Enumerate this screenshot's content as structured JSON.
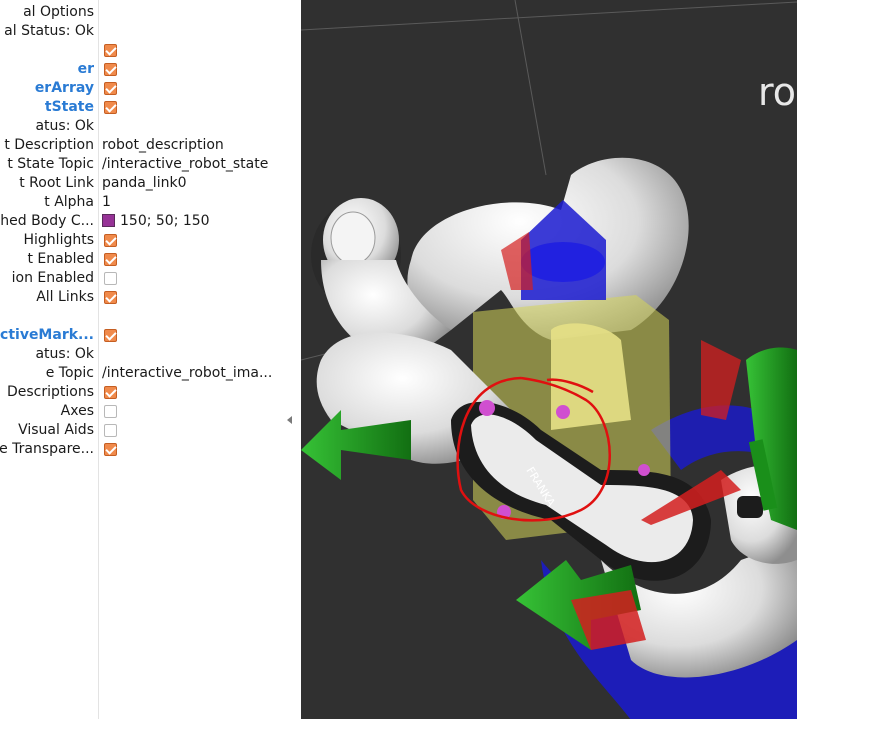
{
  "panel": {
    "rows": [
      {
        "name": "al Options",
        "type": "header"
      },
      {
        "name": "al Status: Ok",
        "type": "text"
      },
      {
        "name": "",
        "checked": true,
        "type": "check"
      },
      {
        "name": "er",
        "checked": true,
        "type": "link-check"
      },
      {
        "name": "erArray",
        "checked": true,
        "type": "link-check"
      },
      {
        "name": "tState",
        "checked": true,
        "type": "link-check"
      },
      {
        "name": "atus: Ok",
        "type": "text"
      },
      {
        "name": "t Description",
        "value": "robot_description",
        "type": "value"
      },
      {
        "name": "t State Topic",
        "value": "/interactive_robot_state",
        "type": "value"
      },
      {
        "name": "t Root Link",
        "value": "panda_link0",
        "type": "value"
      },
      {
        "name": "t Alpha",
        "value": "1",
        "type": "value"
      },
      {
        "name": "hed Body C...",
        "value": "150; 50; 150",
        "color": "#963296",
        "type": "color"
      },
      {
        "name": "Highlights",
        "checked": true,
        "type": "check"
      },
      {
        "name": "t Enabled",
        "checked": true,
        "type": "check"
      },
      {
        "name": "ion Enabled",
        "checked": false,
        "type": "check"
      },
      {
        "name": "All Links",
        "checked": true,
        "type": "check"
      },
      {
        "name": "",
        "type": "blank"
      },
      {
        "name": "activeMark...",
        "checked": true,
        "type": "link-check"
      },
      {
        "name": "atus: Ok",
        "type": "text"
      },
      {
        "name": "e Topic",
        "value": "/interactive_robot_ima...",
        "type": "value"
      },
      {
        "name": "Descriptions",
        "checked": true,
        "type": "check"
      },
      {
        "name": "Axes",
        "checked": false,
        "type": "check"
      },
      {
        "name": "Visual Aids",
        "checked": false,
        "type": "check"
      },
      {
        "name": "e Transpare...",
        "checked": true,
        "type": "check"
      }
    ]
  },
  "viewport": {
    "overlay_text": "ro",
    "handwritten_label": "FRANKA",
    "colors": {
      "background": "#303030",
      "marker_green": "#1f9e1f",
      "marker_red": "#d41f1f",
      "marker_blue": "#1a1ad0",
      "marker_yellow": "#d6d65a",
      "annotation_red": "#e01010",
      "link_white": "#e9e9e9",
      "link_dark": "#1c1c1c"
    }
  }
}
